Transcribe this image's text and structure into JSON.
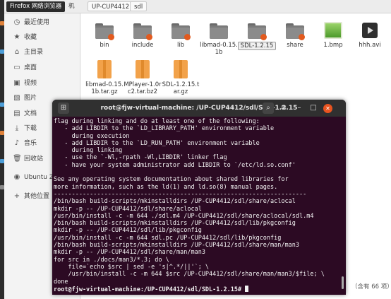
{
  "header": {
    "tooltip": "Firefox 网络浏览器",
    "tab_partial": "机",
    "breadcrumbs": [
      "UP-CUP4412",
      "sdl"
    ]
  },
  "sidebar": {
    "items": [
      {
        "label": "最近使用",
        "icon": "clock-icon"
      },
      {
        "label": "收藏",
        "icon": "star-icon"
      },
      {
        "label": "主目录",
        "icon": "home-icon"
      },
      {
        "label": "桌面",
        "icon": "desktop-icon"
      },
      {
        "label": "视频",
        "icon": "video-icon"
      },
      {
        "label": "图片",
        "icon": "picture-icon"
      },
      {
        "label": "文档",
        "icon": "document-icon"
      },
      {
        "label": "下载",
        "icon": "download-icon"
      },
      {
        "label": "音乐",
        "icon": "music-icon"
      },
      {
        "label": "回收站",
        "icon": "trash-icon"
      },
      {
        "label": "Ubuntu 20.",
        "icon": "disc-icon"
      },
      {
        "label": "其他位置",
        "icon": "plus-icon"
      }
    ]
  },
  "files": [
    {
      "name": "bin",
      "type": "folder"
    },
    {
      "name": "include",
      "type": "folder"
    },
    {
      "name": "lib",
      "type": "folder"
    },
    {
      "name": "libmad-0.15.1b",
      "type": "folder-plain"
    },
    {
      "name": "SDL-1.2.15",
      "type": "folder",
      "selected": true
    },
    {
      "name": "share",
      "type": "folder"
    },
    {
      "name": "1.bmp",
      "type": "image"
    },
    {
      "name": "hhh.avi",
      "type": "video"
    },
    {
      "name": "libmad-0.15.1b.tar.gz",
      "type": "archive"
    },
    {
      "name": "MPlayer-1.0rc2.tar.bz2",
      "type": "archive"
    },
    {
      "name": "SDL-1.2.15.tar.gz",
      "type": "archive"
    }
  ],
  "terminal": {
    "title": "root@fjw-virtual-machine: /UP-CUP4412/sdl/SDL-1.2.15",
    "lines": [
      "flag during linking and do at least one of the following:",
      "   - add LIBDIR to the `LD_LIBRARY_PATH' environment variable",
      "     during execution",
      "   - add LIBDIR to the `LD_RUN_PATH' environment variable",
      "     during linking",
      "   - use the `-Wl,-rpath -Wl,LIBDIR' linker flag",
      "   - have your system administrator add LIBDIR to `/etc/ld.so.conf'",
      "",
      "See any operating system documentation about shared libraries for",
      "more information, such as the ld(1) and ld.so(8) manual pages.",
      "----------------------------------------------------------------------",
      "/bin/bash build-scripts/mkinstalldirs /UP-CUP4412/sdl/share/aclocal",
      "mkdir -p -- /UP-CUP4412/sdl/share/aclocal",
      "/usr/bin/install -c -m 644 ./sdl.m4 /UP-CUP4412/sdl/share/aclocal/sdl.m4",
      "/bin/bash build-scripts/mkinstalldirs /UP-CUP4412/sdl/lib/pkgconfig",
      "mkdir -p -- /UP-CUP4412/sdl/lib/pkgconfig",
      "/usr/bin/install -c -m 644 sdl.pc /UP-CUP4412/sdl/lib/pkgconfig",
      "/bin/bash build-scripts/mkinstalldirs /UP-CUP4412/sdl/share/man/man3",
      "mkdir -p -- /UP-CUP4412/sdl/share/man/man3",
      "for src in ./docs/man3/*.3; do \\",
      "    file=`echo $src | sed -e 's|^.*/||'`; \\",
      "    /usr/bin/install -c -m 644 $src /UP-CUP4412/sdl/share/man/man3/$file; \\",
      "done"
    ],
    "prompt": "root@fjw-virtual-machine:/UP-CUP4412/sdl/SDL-1.2.15# "
  },
  "status": "（含有 66 项）",
  "colors": {
    "terminal_bg": "#2c0a23",
    "folder_accent": "#e25a1e",
    "archive": "#f2a24a",
    "close_button": "#e95420"
  }
}
